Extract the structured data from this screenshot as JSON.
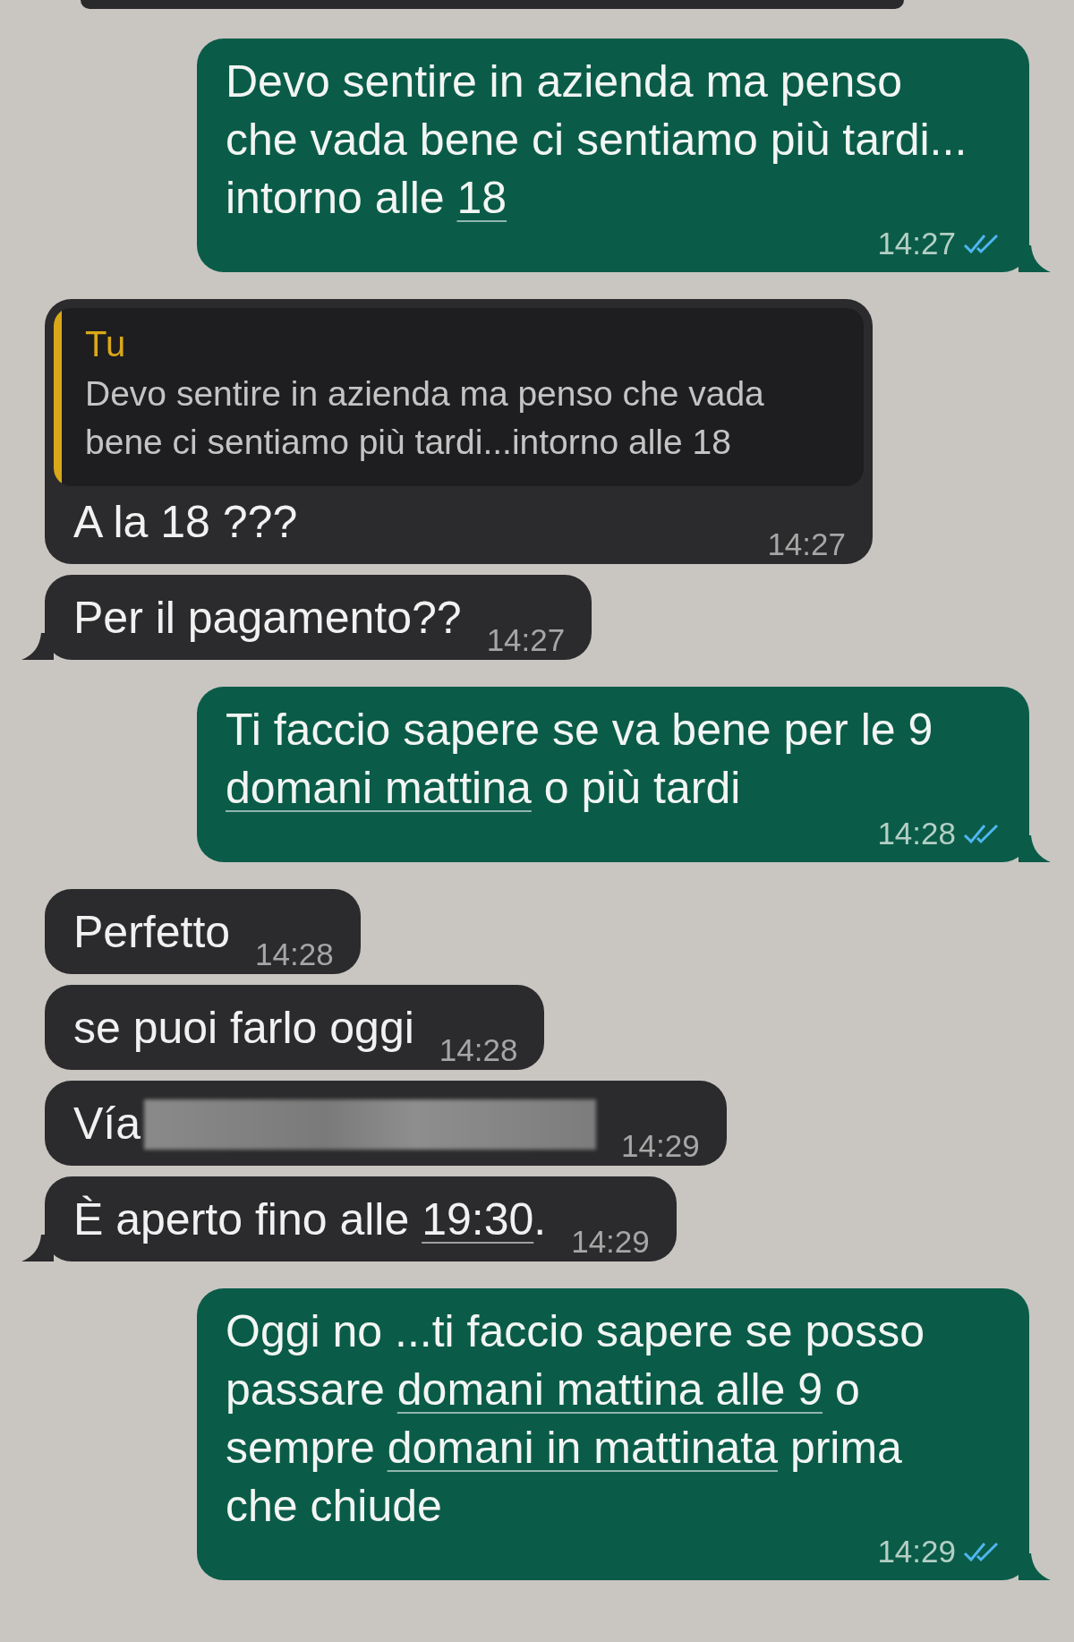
{
  "messages": [
    {
      "kind": "outgoing",
      "tail": true,
      "segments": [
        {
          "text": "Devo sentire in azienda ma penso che vada bene ci sentiamo più tardi... intorno alle "
        },
        {
          "text": "18",
          "link": true
        }
      ],
      "time": "14:27",
      "read": true
    },
    {
      "kind": "incoming",
      "tail": false,
      "quote": {
        "author": "Tu",
        "text": "Devo sentire in azienda ma penso che vada bene ci sentiamo più tardi...intorno alle 18"
      },
      "segments": [
        {
          "text": "A la 18 ???"
        }
      ],
      "time": "14:27"
    },
    {
      "kind": "incoming",
      "tail": true,
      "segments": [
        {
          "text": "Per il pagamento??"
        }
      ],
      "time": "14:27"
    },
    {
      "kind": "outgoing",
      "tail": true,
      "segments": [
        {
          "text": "Ti faccio sapere se va bene per le 9 "
        },
        {
          "text": "domani mattina",
          "link": true
        },
        {
          "text": " o più tardi"
        }
      ],
      "time": "14:28",
      "read": true
    },
    {
      "kind": "incoming",
      "tail": false,
      "segments": [
        {
          "text": "Perfetto"
        }
      ],
      "time": "14:28"
    },
    {
      "kind": "incoming",
      "tail": false,
      "segments": [
        {
          "text": "se puoi farlo oggi"
        }
      ],
      "time": "14:28"
    },
    {
      "kind": "incoming",
      "tail": false,
      "redacted": true,
      "segments": [
        {
          "text": "Vía"
        }
      ],
      "time": "14:29"
    },
    {
      "kind": "incoming",
      "tail": true,
      "segments": [
        {
          "text": "È aperto fino alle "
        },
        {
          "text": "19:30",
          "link": true
        },
        {
          "text": "."
        }
      ],
      "time": "14:29"
    },
    {
      "kind": "outgoing",
      "tail": true,
      "segments": [
        {
          "text": "Oggi no ...ti faccio sapere se posso passare "
        },
        {
          "text": "domani mattina alle 9",
          "link": true
        },
        {
          "text": " o sempre "
        },
        {
          "text": "domani in mattinata",
          "link": true
        },
        {
          "text": " prima che chiude"
        }
      ],
      "time": "14:29",
      "read": true
    }
  ]
}
